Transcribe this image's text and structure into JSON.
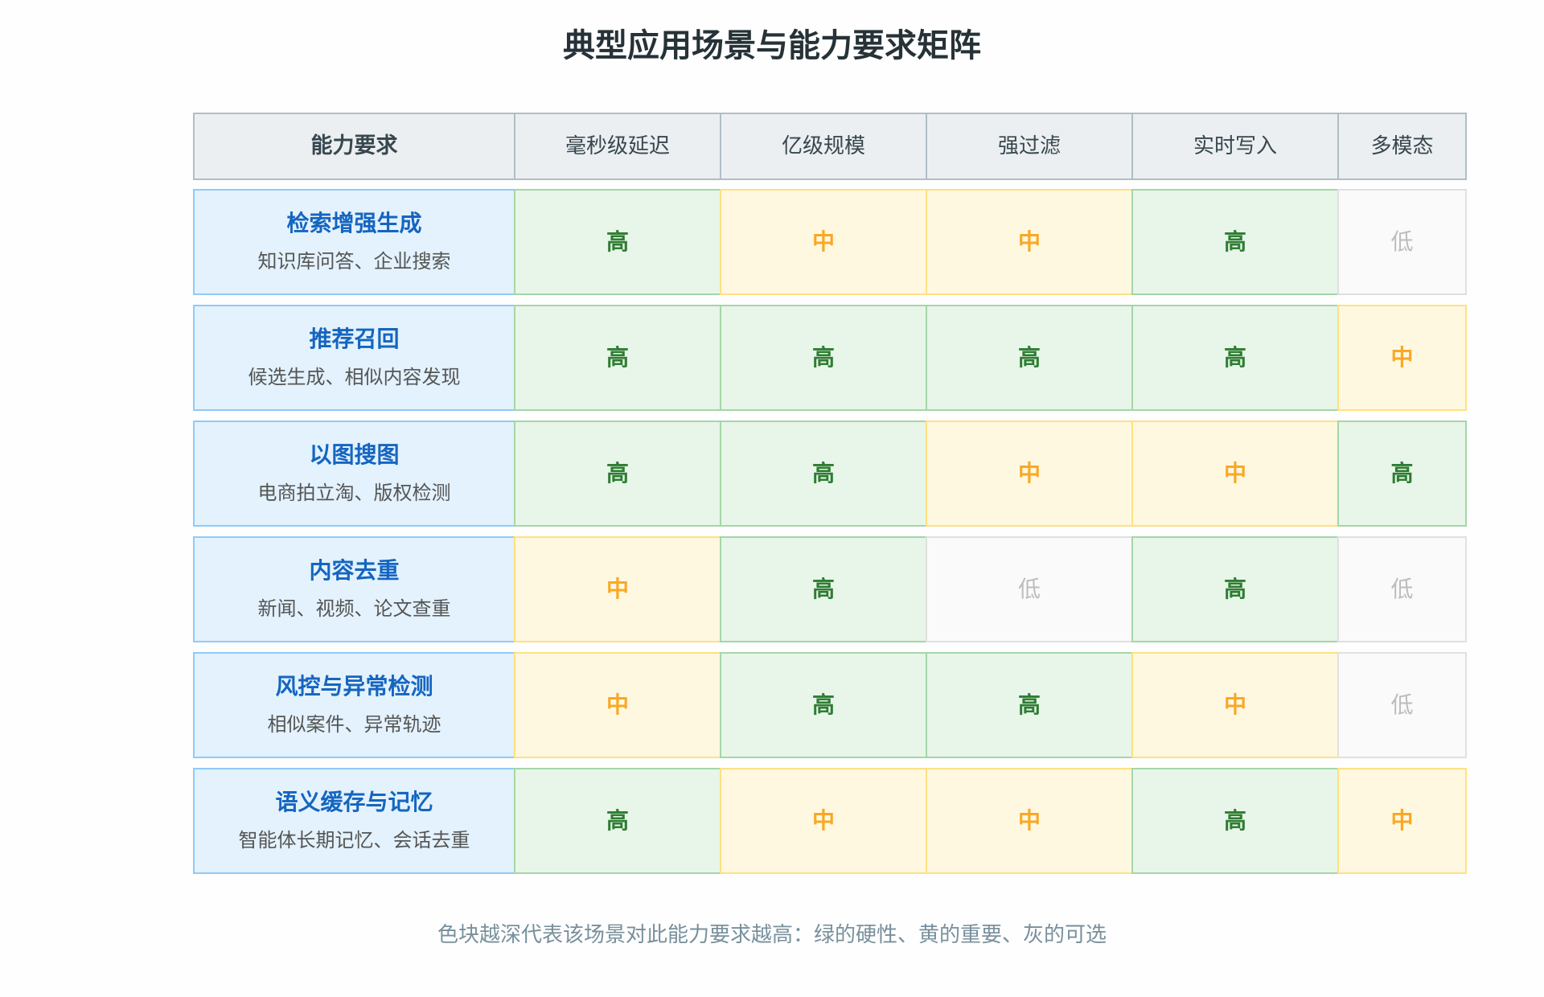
{
  "title": "典型应用场景与能力要求矩阵",
  "header": {
    "corner": "能力要求",
    "columns": [
      "毫秒级延迟",
      "亿级规模",
      "强过滤",
      "实时写入",
      "多模态"
    ]
  },
  "rows": [
    {
      "title": "检索增强生成",
      "subtitle": "知识库问答、企业搜索",
      "values": [
        "高",
        "中",
        "中",
        "高",
        "低"
      ]
    },
    {
      "title": "推荐召回",
      "subtitle": "候选生成、相似内容发现",
      "values": [
        "高",
        "高",
        "高",
        "高",
        "中"
      ]
    },
    {
      "title": "以图搜图",
      "subtitle": "电商拍立淘、版权检测",
      "values": [
        "高",
        "高",
        "中",
        "中",
        "高"
      ]
    },
    {
      "title": "内容去重",
      "subtitle": "新闻、视频、论文查重",
      "values": [
        "中",
        "高",
        "低",
        "高",
        "低"
      ]
    },
    {
      "title": "风控与异常检测",
      "subtitle": "相似案件、异常轨迹",
      "values": [
        "中",
        "高",
        "高",
        "中",
        "低"
      ]
    },
    {
      "title": "语义缓存与记忆",
      "subtitle": "智能体长期记忆、会话去重",
      "values": [
        "高",
        "中",
        "中",
        "高",
        "中"
      ]
    }
  ],
  "footnote": "色块越深代表该场景对此能力要求越高：绿的硬性、黄的重要、灰的可选",
  "colors": {
    "title": "#263238",
    "header_bg": "#eceff1",
    "header_border": "#b0bec5",
    "header_text": "#37474f",
    "scenario_bg": "#e3f2fd",
    "scenario_border": "#90caf9",
    "scenario_title": "#1565c0",
    "scenario_subtitle": "#555555",
    "footnote": "#78909c",
    "page_bg": "#fefefe"
  },
  "level_colors": {
    "高": {
      "bg": "#e8f5e9",
      "border": "#a5d6a7",
      "text": "#2e7d32",
      "emphasized": true
    },
    "中": {
      "bg": "#fff8e1",
      "border": "#ffe082",
      "text": "#f9a825",
      "emphasized": true
    },
    "低": {
      "bg": "#fafafa",
      "border": "#e0e0e0",
      "text": "#bdbdbd",
      "emphasized": false
    }
  }
}
